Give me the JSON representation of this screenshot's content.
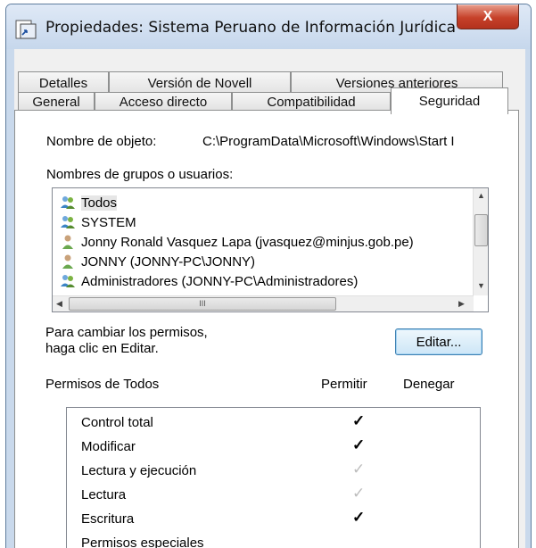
{
  "window": {
    "title": "Propiedades: Sistema Peruano de Información Jurídica",
    "close_label": "X"
  },
  "tabs": {
    "row1": [
      "Detalles",
      "Versión de Novell",
      "Versiones anteriores"
    ],
    "row2": [
      "General",
      "Acceso directo",
      "Compatibilidad",
      "Seguridad"
    ],
    "active": "Seguridad"
  },
  "security": {
    "object_name_label": "Nombre de objeto:",
    "object_name_value": "C:\\ProgramData\\Microsoft\\Windows\\Start I",
    "groups_label": "Nombres de grupos o usuarios:",
    "groups": [
      {
        "name": "Todos",
        "icon": "users-group-icon",
        "selected": true
      },
      {
        "name": "SYSTEM",
        "icon": "users-group-icon",
        "selected": false
      },
      {
        "name": "Jonny Ronald Vasquez Lapa (jvasquez@minjus.gob.pe)",
        "icon": "user-icon",
        "selected": false
      },
      {
        "name": "JONNY (JONNY-PC\\JONNY)",
        "icon": "user-icon",
        "selected": false
      },
      {
        "name": "Administradores (JONNY-PC\\Administradores)",
        "icon": "users-group-icon",
        "selected": false
      }
    ],
    "hscroll_grip": "III",
    "change_hint_line1": "Para cambiar los permisos,",
    "change_hint_line2": "haga clic en Editar.",
    "edit_button": "Editar...",
    "permissions_label": "Permisos de Todos",
    "allow_header": "Permitir",
    "deny_header": "Denegar",
    "permissions": [
      {
        "name": "Control total",
        "allow": "✓",
        "allow_state": "checked"
      },
      {
        "name": "Modificar",
        "allow": "✓",
        "allow_state": "checked"
      },
      {
        "name": "Lectura y ejecución",
        "allow": "✓",
        "allow_state": "inherited"
      },
      {
        "name": "Lectura",
        "allow": "✓",
        "allow_state": "inherited"
      },
      {
        "name": "Escritura",
        "allow": "✓",
        "allow_state": "checked"
      },
      {
        "name": "Permisos especiales",
        "allow": "",
        "allow_state": "none"
      }
    ]
  }
}
